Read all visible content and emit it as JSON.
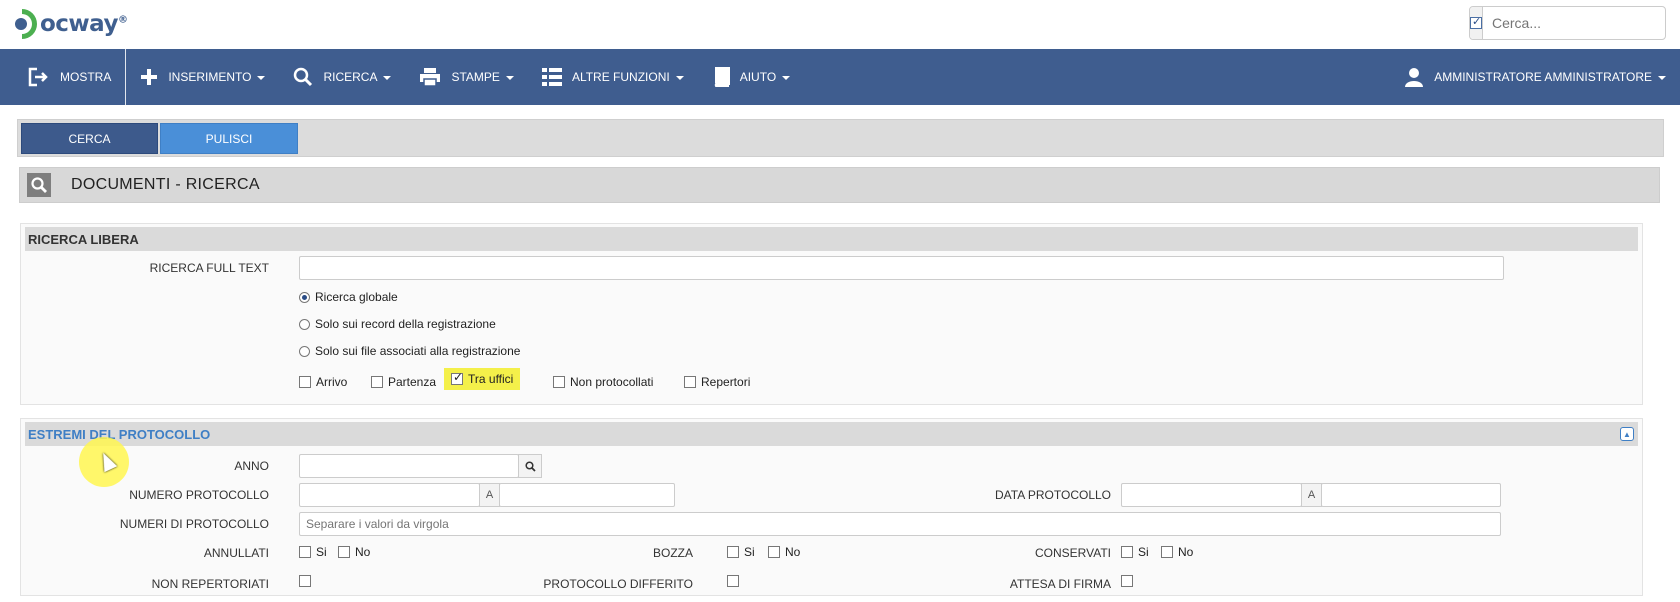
{
  "app": {
    "logo_text": "ocway",
    "logo_reg": "®",
    "search_placeholder": "Cerca..."
  },
  "nav": {
    "items": [
      {
        "label": "MOSTRA",
        "icon": "sign-out-icon",
        "has_caret": false
      },
      {
        "label": "INSERIMENTO",
        "icon": "plus-icon",
        "has_caret": true
      },
      {
        "label": "RICERCA",
        "icon": "search-icon",
        "has_caret": true
      },
      {
        "label": "STAMPE",
        "icon": "printer-icon",
        "has_caret": true
      },
      {
        "label": "ALTRE FUNZIONI",
        "icon": "list-icon",
        "has_caret": true
      },
      {
        "label": "AIUTO",
        "icon": "book-icon",
        "has_caret": true
      }
    ],
    "user": "AMMINISTRATORE AMMINISTRATORE"
  },
  "toolbar": {
    "search_label": "CERCA",
    "clear_label": "PULISCI"
  },
  "page": {
    "title": "DOCUMENTI - RICERCA"
  },
  "ricerca_libera": {
    "heading": "RICERCA LIBERA",
    "fulltext_label": "RICERCA FULL TEXT",
    "fulltext_value": "",
    "radios": [
      {
        "label": "Ricerca globale",
        "checked": true
      },
      {
        "label": "Solo sui record della registrazione",
        "checked": false
      },
      {
        "label": "Solo sui file associati alla registrazione",
        "checked": false
      }
    ],
    "checks": [
      {
        "label": "Arrivo",
        "checked": false
      },
      {
        "label": "Partenza",
        "checked": false
      },
      {
        "label": "Tra uffici",
        "checked": true
      },
      {
        "label": "Non protocollati",
        "checked": false
      },
      {
        "label": "Repertori",
        "checked": false
      }
    ]
  },
  "estremi": {
    "heading": "ESTREMI DEL PROTOCOLLO",
    "anno_label": "ANNO",
    "numero_label": "NUMERO PROTOCOLLO",
    "range_sep": "A",
    "data_label": "DATA PROTOCOLLO",
    "numeri_label": "NUMERI DI PROTOCOLLO",
    "numeri_placeholder": "Separare i valori da virgola",
    "annullati_label": "ANNULLATI",
    "bozza_label": "BOZZA",
    "conservati_label": "CONSERVATI",
    "si": "Si",
    "no": "No",
    "non_repertoriati_label": "NON REPERTORIATI",
    "differito_label": "PROTOCOLLO DIFFERITO",
    "firma_label": "ATTESA DI FIRMA"
  }
}
